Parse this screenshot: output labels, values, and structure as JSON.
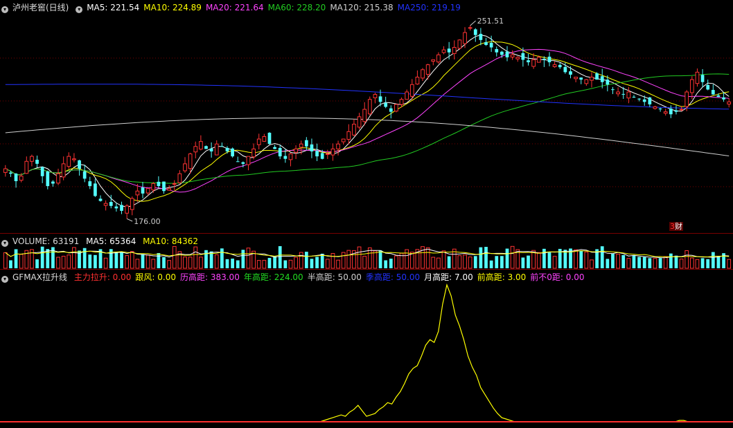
{
  "price_panel": {
    "title": "泸州老窖(日线)",
    "ma": [
      {
        "label": "MA5: 221.54",
        "color": "#ffffff"
      },
      {
        "label": "MA10: 224.89",
        "color": "#ffff00"
      },
      {
        "label": "MA20: 221.64",
        "color": "#ff44ff"
      },
      {
        "label": "MA60: 228.20",
        "color": "#22cc22"
      },
      {
        "label": "MA120: 215.38",
        "color": "#d0d0d0"
      },
      {
        "label": "MA250: 219.19",
        "color": "#2233ff"
      }
    ],
    "high_label": "251.51",
    "low_label": "176.00",
    "badge_num": "3",
    "badge_text": "财"
  },
  "volume_panel": {
    "title": "VOLUME: 63191",
    "ma5": "MA5: 65364",
    "ma10": "MA10: 84362"
  },
  "indicator_panel": {
    "title": "GFMAX拉升线",
    "items": [
      {
        "label": "主力拉升: 0.00",
        "color": "#ff3030"
      },
      {
        "label": "跟风: 0.00",
        "color": "#ffff00"
      },
      {
        "label": "历高距: 383.00",
        "color": "#ff44ff"
      },
      {
        "label": "年高距: 224.00",
        "color": "#22dd22"
      },
      {
        "label": "半高距: 50.00",
        "color": "#d0d0d0"
      },
      {
        "label": "季高距: 50.00",
        "color": "#2233ff"
      },
      {
        "label": "月高距: 7.00",
        "color": "#ffffff"
      },
      {
        "label": "前高距: 3.00",
        "color": "#ffff00"
      },
      {
        "label": "前不0距: 0.00",
        "color": "#ff44ff"
      }
    ]
  },
  "colors": {
    "up": "#ff3333",
    "down": "#54ffff",
    "grid": "#7a0000"
  },
  "chart_data": [
    {
      "type": "candlestick",
      "title": "泸州老窖(日线)",
      "ylim": [
        170,
        256
      ],
      "annotations": [
        "251.51",
        "176.00"
      ],
      "series": [
        {
          "name": "MA5",
          "last": 221.54
        },
        {
          "name": "MA10",
          "last": 224.89
        },
        {
          "name": "MA20",
          "last": 221.64
        },
        {
          "name": "MA60",
          "last": 228.2
        },
        {
          "name": "MA120",
          "last": 215.38
        },
        {
          "name": "MA250",
          "last": 219.19
        }
      ],
      "closes": [
        194,
        192,
        189,
        191,
        197,
        199,
        196,
        191,
        187,
        188,
        192,
        196,
        199,
        198,
        194,
        190,
        187,
        183,
        181,
        180,
        179,
        178,
        177,
        179,
        182,
        185,
        184,
        186,
        188,
        187,
        185,
        186,
        188,
        192,
        196,
        200,
        203,
        205,
        202,
        201,
        204,
        203,
        201,
        199,
        197,
        196,
        199,
        202,
        206,
        207,
        204,
        202,
        199,
        198,
        200,
        202,
        204,
        203,
        201,
        199,
        198,
        200,
        202,
        204,
        206,
        209,
        212,
        215,
        218,
        222,
        224,
        221,
        219,
        217,
        220,
        222,
        225,
        228,
        231,
        234,
        236,
        238,
        240,
        242,
        241,
        243,
        246,
        249,
        251,
        248,
        246,
        244,
        243,
        241,
        240,
        239,
        240,
        239,
        238,
        237,
        238,
        239,
        238,
        237,
        236,
        235,
        233,
        232,
        231,
        230,
        230,
        231,
        230,
        229,
        228,
        226,
        225,
        224,
        225,
        223,
        222,
        221,
        220,
        219,
        218,
        217,
        216,
        217,
        218,
        225,
        230,
        233,
        229,
        226,
        224,
        223,
        222,
        221
      ]
    },
    {
      "type": "bar",
      "title": "VOLUME",
      "series": [
        {
          "name": "VOLUME",
          "last": 63191
        },
        {
          "name": "MA5",
          "last": 65364
        },
        {
          "name": "MA10",
          "last": 84362
        }
      ]
    },
    {
      "type": "line",
      "title": "GFMAX拉升线",
      "series": [
        {
          "name": "跟风",
          "values": [
            0,
            0,
            0,
            0,
            0,
            0,
            0,
            0,
            0,
            0,
            0,
            0,
            0,
            0,
            0,
            0,
            0,
            0,
            0,
            0,
            0,
            0,
            0,
            0,
            0,
            0,
            0,
            0,
            0,
            0,
            0,
            0,
            0,
            0,
            0,
            0,
            0,
            0,
            0,
            0,
            0,
            0,
            0,
            0,
            0,
            0,
            0,
            0,
            0,
            0,
            0,
            0,
            0,
            0,
            0,
            0,
            0,
            0,
            0,
            0,
            0,
            0,
            0,
            0,
            0,
            0,
            0,
            0,
            0,
            0,
            0,
            0,
            0,
            0,
            0,
            0,
            1,
            2,
            3,
            4,
            5,
            4,
            7,
            9,
            12,
            8,
            4,
            5,
            6,
            9,
            11,
            14,
            13,
            18,
            22,
            28,
            35,
            39,
            41,
            48,
            56,
            60,
            58,
            66,
            86,
            100,
            92,
            78,
            70,
            60,
            48,
            40,
            34,
            25,
            20,
            15,
            10,
            6,
            3,
            2,
            1,
            0,
            0,
            0,
            0,
            0,
            0,
            0,
            0,
            0,
            0,
            0,
            0,
            0,
            0,
            0,
            0,
            0,
            0,
            0,
            0,
            0,
            0,
            0,
            0,
            0,
            0,
            0,
            0,
            0,
            0,
            0,
            0,
            0,
            0,
            0,
            0,
            0,
            0,
            0,
            1,
            1,
            0,
            0,
            0,
            0,
            0,
            0,
            0,
            0,
            0,
            0,
            0
          ]
        },
        {
          "name": "主力拉升",
          "values": [
            0
          ]
        }
      ]
    }
  ]
}
